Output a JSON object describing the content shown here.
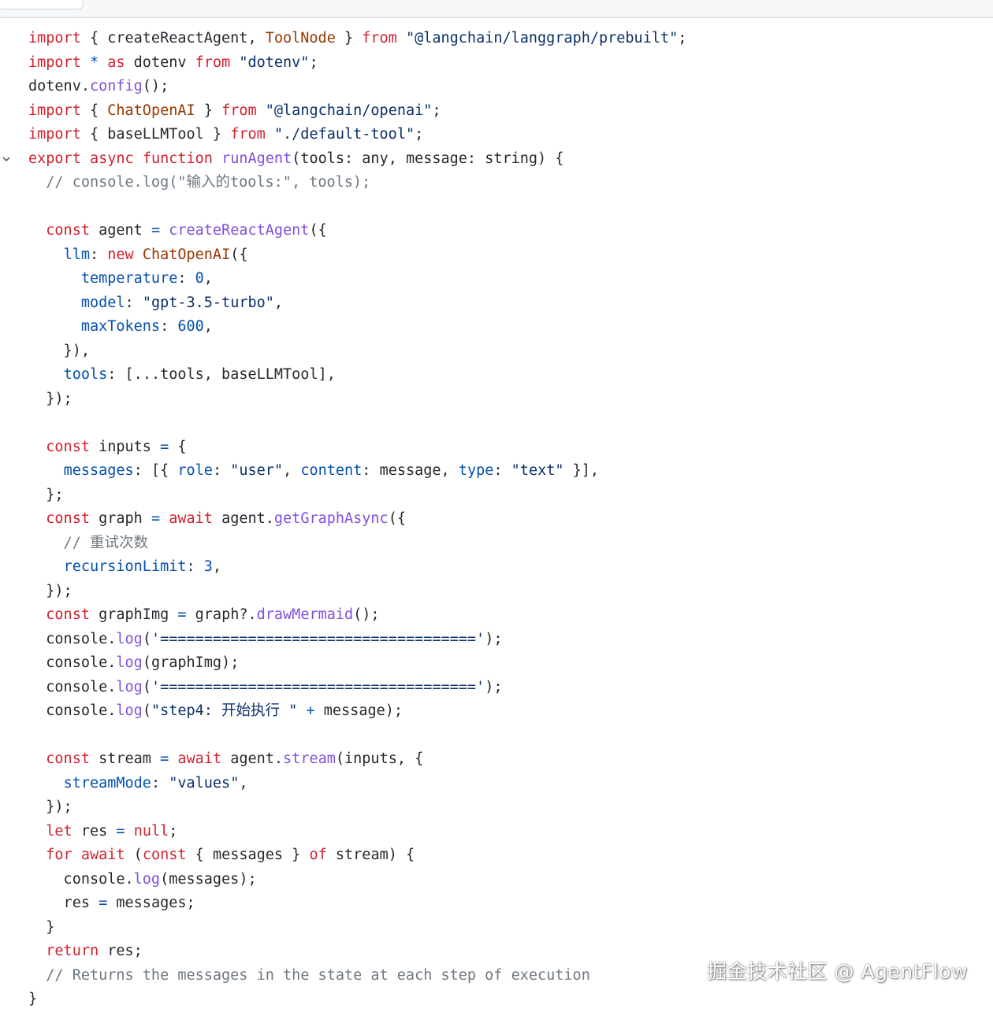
{
  "colors": {
    "keyword": "#cf222e",
    "string": "#0a3069",
    "function": "#8250df",
    "class": "#953800",
    "property": "#0550ae",
    "comment": "#6e7781",
    "text": "#24292f"
  },
  "fold_icon": "chevron-down-icon",
  "watermark": "掘金技术社区 @ AgentFlow",
  "lines": [
    {
      "fold": false,
      "tokens": [
        [
          "kw",
          "import"
        ],
        [
          "txt",
          " { createReactAgent, "
        ],
        [
          "cls",
          "ToolNode"
        ],
        [
          "txt",
          " } "
        ],
        [
          "kw",
          "from"
        ],
        [
          "txt",
          " "
        ],
        [
          "str",
          "\"@langchain/langgraph/prebuilt\""
        ],
        [
          "txt",
          ";"
        ]
      ]
    },
    {
      "fold": false,
      "tokens": [
        [
          "kw",
          "import"
        ],
        [
          "txt",
          " "
        ],
        [
          "op",
          "*"
        ],
        [
          "txt",
          " "
        ],
        [
          "kw",
          "as"
        ],
        [
          "txt",
          " dotenv "
        ],
        [
          "kw",
          "from"
        ],
        [
          "txt",
          " "
        ],
        [
          "str",
          "\"dotenv\""
        ],
        [
          "txt",
          ";"
        ]
      ]
    },
    {
      "fold": false,
      "tokens": [
        [
          "txt",
          "dotenv."
        ],
        [
          "fn",
          "config"
        ],
        [
          "txt",
          "();"
        ]
      ]
    },
    {
      "fold": false,
      "tokens": [
        [
          "kw",
          "import"
        ],
        [
          "txt",
          " { "
        ],
        [
          "cls",
          "ChatOpenAI"
        ],
        [
          "txt",
          " } "
        ],
        [
          "kw",
          "from"
        ],
        [
          "txt",
          " "
        ],
        [
          "str",
          "\"@langchain/openai\""
        ],
        [
          "txt",
          ";"
        ]
      ]
    },
    {
      "fold": false,
      "tokens": [
        [
          "kw",
          "import"
        ],
        [
          "txt",
          " { baseLLMTool } "
        ],
        [
          "kw",
          "from"
        ],
        [
          "txt",
          " "
        ],
        [
          "str",
          "\"./default-tool\""
        ],
        [
          "txt",
          ";"
        ]
      ]
    },
    {
      "fold": true,
      "tokens": [
        [
          "kw",
          "export"
        ],
        [
          "txt",
          " "
        ],
        [
          "kw",
          "async"
        ],
        [
          "txt",
          " "
        ],
        [
          "kw",
          "function"
        ],
        [
          "txt",
          " "
        ],
        [
          "fn",
          "runAgent"
        ],
        [
          "txt",
          "(tools: any, message: string) {"
        ]
      ]
    },
    {
      "fold": false,
      "tokens": [
        [
          "cmt",
          "  // console.log(\"输入的tools:\", tools);"
        ]
      ]
    },
    {
      "fold": false,
      "tokens": []
    },
    {
      "fold": false,
      "tokens": [
        [
          "txt",
          "  "
        ],
        [
          "kw",
          "const"
        ],
        [
          "txt",
          " agent "
        ],
        [
          "op",
          "="
        ],
        [
          "txt",
          " "
        ],
        [
          "fn",
          "createReactAgent"
        ],
        [
          "txt",
          "({"
        ]
      ]
    },
    {
      "fold": false,
      "tokens": [
        [
          "txt",
          "    "
        ],
        [
          "prop",
          "llm"
        ],
        [
          "txt",
          ": "
        ],
        [
          "kw",
          "new"
        ],
        [
          "txt",
          " "
        ],
        [
          "cls",
          "ChatOpenAI"
        ],
        [
          "txt",
          "({"
        ]
      ]
    },
    {
      "fold": false,
      "tokens": [
        [
          "txt",
          "      "
        ],
        [
          "prop",
          "temperature"
        ],
        [
          "txt",
          ": "
        ],
        [
          "num",
          "0"
        ],
        [
          "txt",
          ","
        ]
      ]
    },
    {
      "fold": false,
      "tokens": [
        [
          "txt",
          "      "
        ],
        [
          "prop",
          "model"
        ],
        [
          "txt",
          ": "
        ],
        [
          "str",
          "\"gpt-3.5-turbo\""
        ],
        [
          "txt",
          ","
        ]
      ]
    },
    {
      "fold": false,
      "tokens": [
        [
          "txt",
          "      "
        ],
        [
          "prop",
          "maxTokens"
        ],
        [
          "txt",
          ": "
        ],
        [
          "num",
          "600"
        ],
        [
          "txt",
          ","
        ]
      ]
    },
    {
      "fold": false,
      "tokens": [
        [
          "txt",
          "    }),"
        ]
      ]
    },
    {
      "fold": false,
      "tokens": [
        [
          "txt",
          "    "
        ],
        [
          "prop",
          "tools"
        ],
        [
          "txt",
          ": [...tools, baseLLMTool],"
        ]
      ]
    },
    {
      "fold": false,
      "tokens": [
        [
          "txt",
          "  });"
        ]
      ]
    },
    {
      "fold": false,
      "tokens": []
    },
    {
      "fold": false,
      "tokens": [
        [
          "txt",
          "  "
        ],
        [
          "kw",
          "const"
        ],
        [
          "txt",
          " inputs "
        ],
        [
          "op",
          "="
        ],
        [
          "txt",
          " {"
        ]
      ]
    },
    {
      "fold": false,
      "tokens": [
        [
          "txt",
          "    "
        ],
        [
          "prop",
          "messages"
        ],
        [
          "txt",
          ": [{ "
        ],
        [
          "prop",
          "role"
        ],
        [
          "txt",
          ": "
        ],
        [
          "str",
          "\"user\""
        ],
        [
          "txt",
          ", "
        ],
        [
          "prop",
          "content"
        ],
        [
          "txt",
          ": message, "
        ],
        [
          "prop",
          "type"
        ],
        [
          "txt",
          ": "
        ],
        [
          "str",
          "\"text\""
        ],
        [
          "txt",
          " }],"
        ]
      ]
    },
    {
      "fold": false,
      "tokens": [
        [
          "txt",
          "  };"
        ]
      ]
    },
    {
      "fold": false,
      "tokens": [
        [
          "txt",
          "  "
        ],
        [
          "kw",
          "const"
        ],
        [
          "txt",
          " graph "
        ],
        [
          "op",
          "="
        ],
        [
          "txt",
          " "
        ],
        [
          "kw",
          "await"
        ],
        [
          "txt",
          " agent."
        ],
        [
          "fn",
          "getGraphAsync"
        ],
        [
          "txt",
          "({"
        ]
      ]
    },
    {
      "fold": false,
      "tokens": [
        [
          "cmt",
          "    // 重试次数"
        ]
      ]
    },
    {
      "fold": false,
      "tokens": [
        [
          "txt",
          "    "
        ],
        [
          "prop",
          "recursionLimit"
        ],
        [
          "txt",
          ": "
        ],
        [
          "num",
          "3"
        ],
        [
          "txt",
          ","
        ]
      ]
    },
    {
      "fold": false,
      "tokens": [
        [
          "txt",
          "  });"
        ]
      ]
    },
    {
      "fold": false,
      "tokens": [
        [
          "txt",
          "  "
        ],
        [
          "kw",
          "const"
        ],
        [
          "txt",
          " graphImg "
        ],
        [
          "op",
          "="
        ],
        [
          "txt",
          " graph?."
        ],
        [
          "fn",
          "drawMermaid"
        ],
        [
          "txt",
          "();"
        ]
      ]
    },
    {
      "fold": false,
      "tokens": [
        [
          "txt",
          "  console."
        ],
        [
          "fn",
          "log"
        ],
        [
          "txt",
          "("
        ],
        [
          "str",
          "'===================================='"
        ],
        [
          "txt",
          ");"
        ]
      ]
    },
    {
      "fold": false,
      "tokens": [
        [
          "txt",
          "  console."
        ],
        [
          "fn",
          "log"
        ],
        [
          "txt",
          "(graphImg);"
        ]
      ]
    },
    {
      "fold": false,
      "tokens": [
        [
          "txt",
          "  console."
        ],
        [
          "fn",
          "log"
        ],
        [
          "txt",
          "("
        ],
        [
          "str",
          "'===================================='"
        ],
        [
          "txt",
          ");"
        ]
      ]
    },
    {
      "fold": false,
      "tokens": [
        [
          "txt",
          "  console."
        ],
        [
          "fn",
          "log"
        ],
        [
          "txt",
          "("
        ],
        [
          "str",
          "\"step4: 开始执行 \""
        ],
        [
          "txt",
          " "
        ],
        [
          "op",
          "+"
        ],
        [
          "txt",
          " message);"
        ]
      ]
    },
    {
      "fold": false,
      "tokens": []
    },
    {
      "fold": false,
      "tokens": [
        [
          "txt",
          "  "
        ],
        [
          "kw",
          "const"
        ],
        [
          "txt",
          " stream "
        ],
        [
          "op",
          "="
        ],
        [
          "txt",
          " "
        ],
        [
          "kw",
          "await"
        ],
        [
          "txt",
          " agent."
        ],
        [
          "fn",
          "stream"
        ],
        [
          "txt",
          "(inputs, {"
        ]
      ]
    },
    {
      "fold": false,
      "tokens": [
        [
          "txt",
          "    "
        ],
        [
          "prop",
          "streamMode"
        ],
        [
          "txt",
          ": "
        ],
        [
          "str",
          "\"values\""
        ],
        [
          "txt",
          ","
        ]
      ]
    },
    {
      "fold": false,
      "tokens": [
        [
          "txt",
          "  });"
        ]
      ]
    },
    {
      "fold": false,
      "tokens": [
        [
          "txt",
          "  "
        ],
        [
          "kw",
          "let"
        ],
        [
          "txt",
          " res "
        ],
        [
          "op",
          "="
        ],
        [
          "txt",
          " "
        ],
        [
          "kw",
          "null"
        ],
        [
          "txt",
          ";"
        ]
      ]
    },
    {
      "fold": false,
      "tokens": [
        [
          "txt",
          "  "
        ],
        [
          "kw",
          "for"
        ],
        [
          "txt",
          " "
        ],
        [
          "kw",
          "await"
        ],
        [
          "txt",
          " ("
        ],
        [
          "kw",
          "const"
        ],
        [
          "txt",
          " { messages } "
        ],
        [
          "kw",
          "of"
        ],
        [
          "txt",
          " stream) {"
        ]
      ]
    },
    {
      "fold": false,
      "tokens": [
        [
          "txt",
          "    console."
        ],
        [
          "fn",
          "log"
        ],
        [
          "txt",
          "(messages);"
        ]
      ]
    },
    {
      "fold": false,
      "tokens": [
        [
          "txt",
          "    res "
        ],
        [
          "op",
          "="
        ],
        [
          "txt",
          " messages;"
        ]
      ]
    },
    {
      "fold": false,
      "tokens": [
        [
          "txt",
          "  }"
        ]
      ]
    },
    {
      "fold": false,
      "tokens": [
        [
          "txt",
          "  "
        ],
        [
          "kw",
          "return"
        ],
        [
          "txt",
          " res;"
        ]
      ]
    },
    {
      "fold": false,
      "tokens": [
        [
          "cmt",
          "  // Returns the messages in the state at each step of execution"
        ]
      ]
    },
    {
      "fold": false,
      "tokens": [
        [
          "txt",
          "}"
        ]
      ]
    }
  ]
}
